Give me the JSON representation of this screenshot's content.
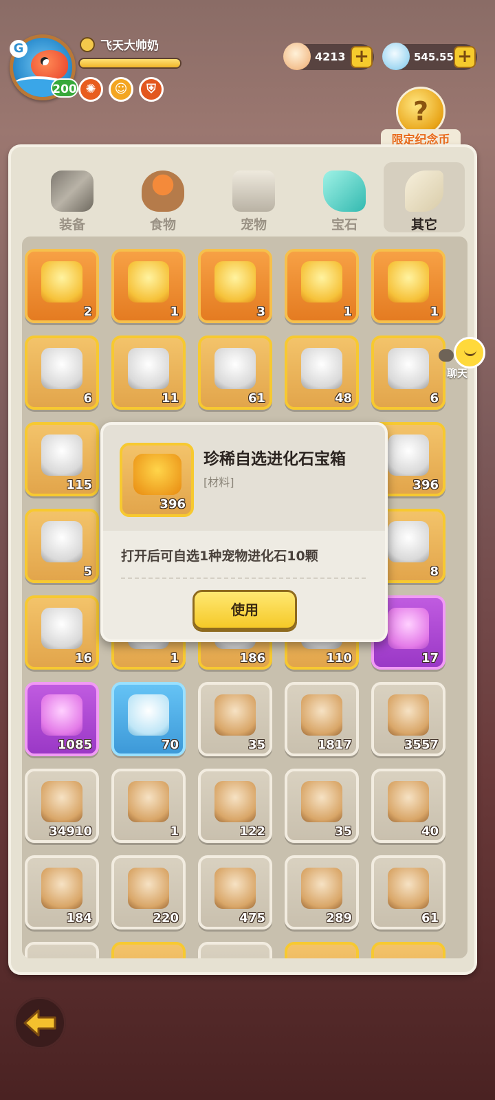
{
  "player": {
    "name": "飞天大帅奶",
    "level": "200",
    "exp_fraction": 1.0,
    "medals": [
      "fire-medal",
      "face-medal",
      "shield-medal"
    ]
  },
  "currency": [
    {
      "icon": "shell-icon",
      "value": "4213"
    },
    {
      "icon": "diamond-icon",
      "value": "545.55M"
    }
  ],
  "event": {
    "label": "限定纪念币",
    "symbol": "?"
  },
  "tabs": [
    {
      "label": "装备",
      "icon": "hammer-icon",
      "active": false
    },
    {
      "label": "食物",
      "icon": "food-bowl-icon",
      "active": false
    },
    {
      "label": "宠物",
      "icon": "dino-skull-icon",
      "active": false
    },
    {
      "label": "宝石",
      "icon": "gem-icon",
      "active": false
    },
    {
      "label": "其它",
      "icon": "bone-icon",
      "active": true
    }
  ],
  "items": [
    {
      "icon": "pet-crystal-icon",
      "count": "2",
      "rarity": "orange"
    },
    {
      "icon": "pet-crystal-icon",
      "count": "1",
      "rarity": "orange"
    },
    {
      "icon": "pet-crystal-icon",
      "count": "3",
      "rarity": "orange"
    },
    {
      "icon": "pet-crystal-icon",
      "count": "1",
      "rarity": "orange"
    },
    {
      "icon": "pet-crystal-icon",
      "count": "1",
      "rarity": "orange"
    },
    {
      "icon": "treasure-chest-icon",
      "count": "6",
      "rarity": "gold"
    },
    {
      "icon": "scroll-horn-icon",
      "count": "11",
      "rarity": "gold"
    },
    {
      "icon": "pickaxe-icon",
      "count": "61",
      "rarity": "gold"
    },
    {
      "icon": "dice-icon",
      "count": "48",
      "rarity": "gold"
    },
    {
      "icon": "heart-icon",
      "count": "6",
      "rarity": "gold"
    },
    {
      "icon": "magnifier-icon",
      "count": "115",
      "rarity": "gold"
    },
    {
      "icon": "hidden",
      "count": "",
      "rarity": "gold"
    },
    {
      "icon": "hidden",
      "count": "",
      "rarity": "gold"
    },
    {
      "icon": "hidden",
      "count": "",
      "rarity": "gold"
    },
    {
      "icon": "evolution-chest-icon",
      "count": "396",
      "rarity": "gold"
    },
    {
      "icon": "magnifier-icon",
      "count": "5",
      "rarity": "gold"
    },
    {
      "icon": "hidden",
      "count": "",
      "rarity": "gold"
    },
    {
      "icon": "hidden",
      "count": "",
      "rarity": "gold"
    },
    {
      "icon": "hidden",
      "count": "",
      "rarity": "gold"
    },
    {
      "icon": "map-scroll-icon",
      "count": "8",
      "rarity": "gold"
    },
    {
      "icon": "blue-ticket-icon",
      "count": "16",
      "rarity": "gold"
    },
    {
      "icon": "partial-item-icon",
      "count": "1",
      "rarity": "gold"
    },
    {
      "icon": "partial-item-icon",
      "count": "186",
      "rarity": "gold"
    },
    {
      "icon": "partial-item-icon",
      "count": "110",
      "rarity": "gold"
    },
    {
      "icon": "purple-potion-icon",
      "count": "17",
      "rarity": "purple"
    },
    {
      "icon": "pink-crystal-icon",
      "count": "1085",
      "rarity": "purple"
    },
    {
      "icon": "water-bottle-icon",
      "count": "70",
      "rarity": "blue"
    },
    {
      "icon": "meat-icon",
      "count": "35",
      "rarity": "gray"
    },
    {
      "icon": "moon-icon",
      "count": "1817",
      "rarity": "gray"
    },
    {
      "icon": "star-icon",
      "count": "3557",
      "rarity": "gray"
    },
    {
      "icon": "rainbow-gem-icon",
      "count": "34910",
      "rarity": "gray"
    },
    {
      "icon": "pet-card-icon",
      "count": "1",
      "rarity": "gray"
    },
    {
      "icon": "blue-rune-icon",
      "count": "122",
      "rarity": "gray"
    },
    {
      "icon": "orange-scroll-icon",
      "count": "35",
      "rarity": "gray"
    },
    {
      "icon": "stone-die-icon",
      "count": "40",
      "rarity": "gray"
    },
    {
      "icon": "paw-ticket-icon",
      "count": "184",
      "rarity": "gray"
    },
    {
      "icon": "green-ticket-icon",
      "count": "220",
      "rarity": "gray"
    },
    {
      "icon": "red-ticket-icon",
      "count": "475",
      "rarity": "gray"
    },
    {
      "icon": "brown-ticket-icon",
      "count": "289",
      "rarity": "gray"
    },
    {
      "icon": "shell-coin-icon",
      "count": "61",
      "rarity": "gray"
    }
  ],
  "popup": {
    "title": "珍稀自选进化石宝箱",
    "tag": "[材料]",
    "count": "396",
    "description": "打开后可自选1种宠物进化石10颗",
    "use_label": "使用"
  },
  "chat": {
    "label": "聊天"
  },
  "colors": {
    "orange": "#e47b21",
    "gold": "#e2a54b",
    "purple": "#9a38c6",
    "blue": "#3d99d8",
    "gray": "#c9c0ae",
    "accent_yellow": "#f5c928"
  }
}
